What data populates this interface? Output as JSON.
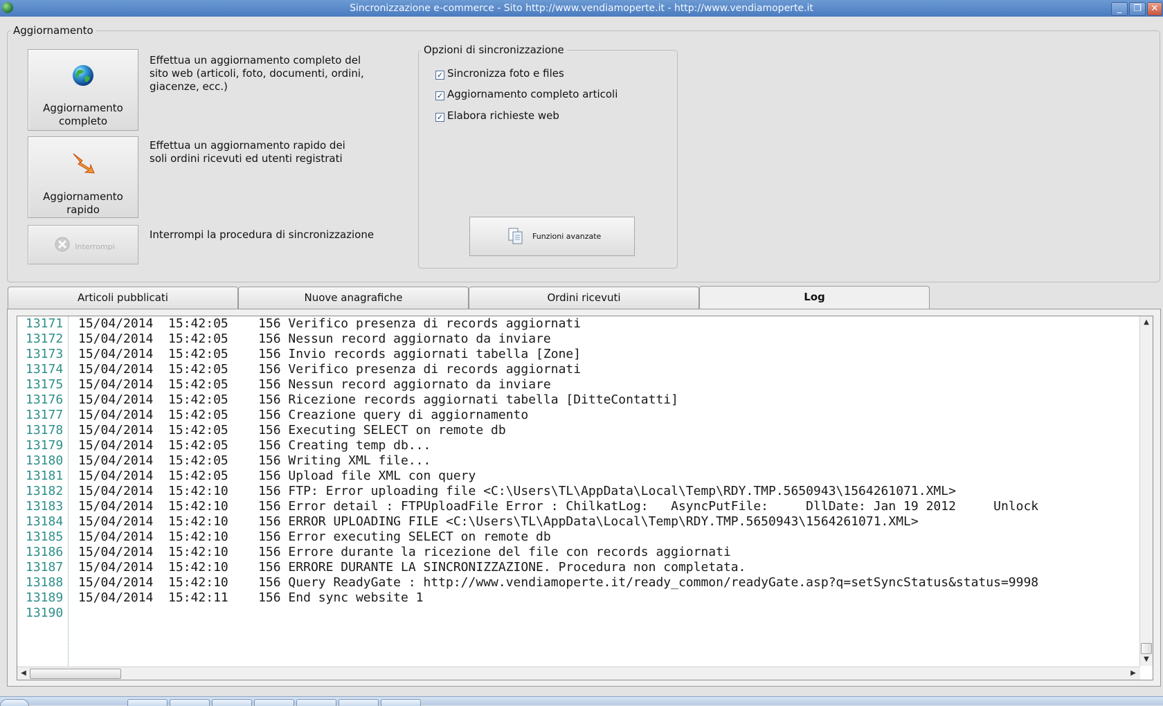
{
  "window": {
    "title": "Sincronizzazione e-commerce - Sito http://www.vendiamoperte.it - http://www.vendiamoperte.it",
    "minimize": "_",
    "restore": "❐",
    "close": "✕"
  },
  "update_group": {
    "legend": "Aggiornamento",
    "full": {
      "label_line1": "Aggiornamento",
      "label_line2": "completo",
      "description_line1": "Effettua un aggiornamento completo del",
      "description_line2": "sito web (articoli, foto, documenti, ordini,",
      "description_line3": "giacenze, ecc.)"
    },
    "quick": {
      "label_line1": "Aggiornamento",
      "label_line2": "rapido",
      "description_line1": "Effettua un aggiornamento rapido dei",
      "description_line2": "soli ordini ricevuti ed utenti registrati"
    },
    "stop": {
      "label": "Interrompi",
      "description": "Interrompi la procedura di sincronizzazione"
    }
  },
  "sync_options": {
    "legend": "Opzioni di sincronizzazione",
    "check_mark": "✓",
    "options": [
      {
        "label": "Sincronizza foto e files",
        "checked": true
      },
      {
        "label": "Aggiornamento completo articoli",
        "checked": true
      },
      {
        "label": "Elabora richieste web",
        "checked": true
      }
    ],
    "advanced_label": "Funzioni avanzate"
  },
  "tabs": [
    {
      "label": "Articoli pubblicati",
      "active": false
    },
    {
      "label": "Nuove anagrafiche",
      "active": false
    },
    {
      "label": "Ordini ricevuti",
      "active": false
    },
    {
      "label": "Log",
      "active": true
    }
  ],
  "log": {
    "lines": [
      {
        "num": "13171",
        "text": "15/04/2014  15:42:05    156 Verifico presenza di records aggiornati"
      },
      {
        "num": "13172",
        "text": "15/04/2014  15:42:05    156 Nessun record aggiornato da inviare"
      },
      {
        "num": "13173",
        "text": "15/04/2014  15:42:05    156 Invio records aggiornati tabella [Zone]"
      },
      {
        "num": "13174",
        "text": "15/04/2014  15:42:05    156 Verifico presenza di records aggiornati"
      },
      {
        "num": "13175",
        "text": "15/04/2014  15:42:05    156 Nessun record aggiornato da inviare"
      },
      {
        "num": "13176",
        "text": "15/04/2014  15:42:05    156 Ricezione records aggiornati tabella [DitteContatti]"
      },
      {
        "num": "13177",
        "text": "15/04/2014  15:42:05    156 Creazione query di aggiornamento"
      },
      {
        "num": "13178",
        "text": "15/04/2014  15:42:05    156 Executing SELECT on remote db"
      },
      {
        "num": "13179",
        "text": "15/04/2014  15:42:05    156 Creating temp db..."
      },
      {
        "num": "13180",
        "text": "15/04/2014  15:42:05    156 Writing XML file..."
      },
      {
        "num": "13181",
        "text": "15/04/2014  15:42:05    156 Upload file XML con query"
      },
      {
        "num": "13182",
        "text": "15/04/2014  15:42:10    156 FTP: Error uploading file <C:\\Users\\TL\\AppData\\Local\\Temp\\RDY.TMP.5650943\\1564261071.XML>"
      },
      {
        "num": "13183",
        "text": "15/04/2014  15:42:10    156 Error detail : FTPUploadFile Error : ChilkatLog:   AsyncPutFile:     DllDate: Jan 19 2012     Unlock"
      },
      {
        "num": "13184",
        "text": "15/04/2014  15:42:10    156 ERROR UPLOADING FILE <C:\\Users\\TL\\AppData\\Local\\Temp\\RDY.TMP.5650943\\1564261071.XML>"
      },
      {
        "num": "13185",
        "text": "15/04/2014  15:42:10    156 Error executing SELECT on remote db"
      },
      {
        "num": "13186",
        "text": "15/04/2014  15:42:10    156 Errore durante la ricezione del file con records aggiornati"
      },
      {
        "num": "13187",
        "text": "15/04/2014  15:42:10    156 ERRORE DURANTE LA SINCRONIZZAZIONE. Procedura non completata."
      },
      {
        "num": "13188",
        "text": "15/04/2014  15:42:10    156 Query ReadyGate : http://www.vendiamoperte.it/ready_common/readyGate.asp?q=setSyncStatus&status=9998"
      },
      {
        "num": "13189",
        "text": "15/04/2014  15:42:11    156 End sync website 1"
      },
      {
        "num": "13190",
        "text": ""
      }
    ]
  },
  "scroll": {
    "up": "▲",
    "down": "▼",
    "left": "◀",
    "right": "▶"
  }
}
